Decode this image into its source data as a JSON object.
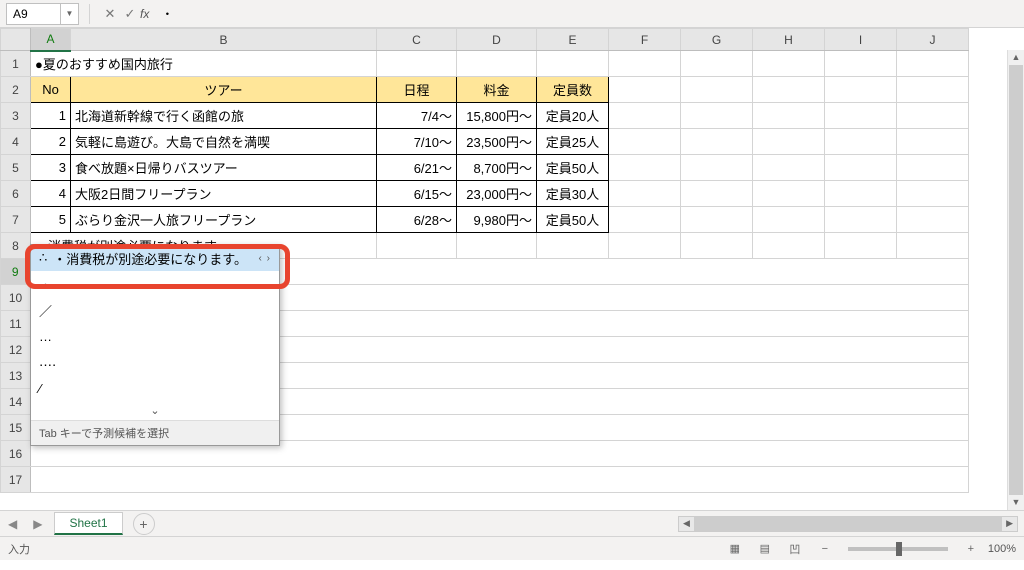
{
  "namebox": {
    "cell_ref": "A9"
  },
  "formula_bar": {
    "value": "・"
  },
  "columns": [
    "A",
    "B",
    "C",
    "D",
    "E",
    "F",
    "G",
    "H",
    "I",
    "J"
  ],
  "row_count": 17,
  "active_row": 9,
  "active_col": "A",
  "content": {
    "title": "●夏のおすすめ国内旅行",
    "headers": {
      "no": "No",
      "tour": "ツアー",
      "date": "日程",
      "price": "料金",
      "cap": "定員数"
    },
    "rows": [
      {
        "no": "1",
        "tour": "北海道新幹線で行く函館の旅",
        "date": "7/4〜",
        "price": "15,800円〜",
        "cap": "定員20人"
      },
      {
        "no": "2",
        "tour": "気軽に島遊び。大島で自然を満喫",
        "date": "7/10〜",
        "price": "23,500円〜",
        "cap": "定員25人"
      },
      {
        "no": "3",
        "tour": "食べ放題×日帰りバスツアー",
        "date": "6/21〜",
        "price": "8,700円〜",
        "cap": "定員50人"
      },
      {
        "no": "4",
        "tour": "大阪2日間フリープラン",
        "date": "6/15〜",
        "price": "23,000円〜",
        "cap": "定員30人"
      },
      {
        "no": "5",
        "tour": "ぶらり金沢一人旅フリープラン",
        "date": "6/28〜",
        "price": "9,980円〜",
        "cap": "定員50人"
      }
    ],
    "note": "・消費税が別途必要になります。"
  },
  "autocomplete": {
    "items": [
      "・消費税が別途必要になります。",
      "・",
      "／",
      "…",
      "‥‥",
      "∕"
    ],
    "selected_index": 0,
    "hint": "Tab キーで予測候補を選択"
  },
  "sheet_tabs": {
    "active": "Sheet1"
  },
  "statusbar": {
    "mode": "入力",
    "zoom": "100%"
  }
}
